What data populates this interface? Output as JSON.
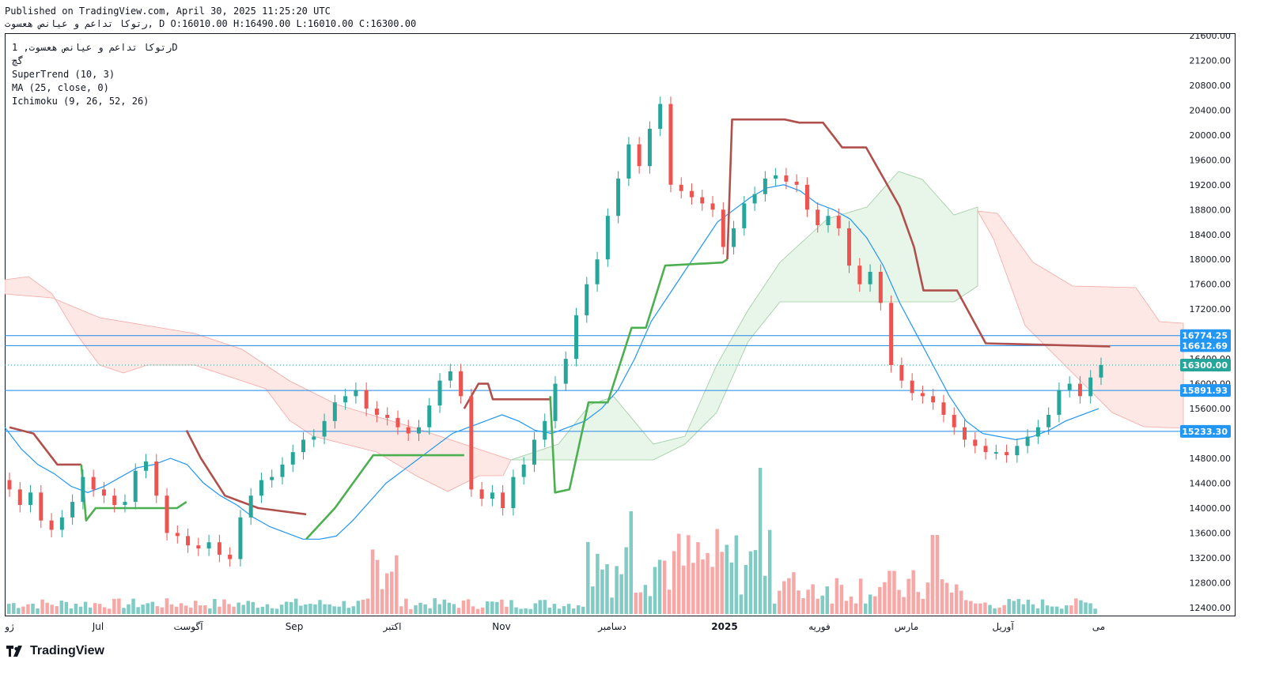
{
  "header": {
    "published_line": "Published on TradingView.com, April 30, 2025 11:25:20 UTC",
    "ohlc_line": "رتوکا تداعم و عیانص هعسوت, D O:16010.00 H:16490.00 L:16010.00 C:16300.00"
  },
  "legend": {
    "symbol_line": "رتوکا تداعم و عیانص هعسوت, 1D",
    "exchange": "گچ",
    "supertrend": "SuperTrend (10, 3)",
    "ma": "MA (25, close, 0)",
    "ichimoku": "Ichimoku (9, 26, 52, 26)"
  },
  "branding": {
    "logo_text": "TradingView"
  },
  "colors": {
    "up": "#26a69a",
    "down": "#ef5350",
    "vol_up": "#80cbc4",
    "vol_down": "#f7a8a6",
    "st_up": "#4caf50",
    "st_down": "#b0504c",
    "ma": "#2196f3",
    "level": "#1e88e5",
    "cloud_green": "#e8f5e9",
    "cloud_red": "#fde8e6"
  },
  "chart_data": {
    "type": "candlestick",
    "symbol": "رتوکا تداعم و عیانص هعسوت",
    "interval": "1D",
    "yaxis": {
      "range": [
        12200,
        21800
      ],
      "ticks": [
        21600,
        21200,
        20800,
        20400,
        20000,
        19600,
        19200,
        18800,
        18400,
        18000,
        17600,
        17200,
        16800,
        16400,
        16000,
        15600,
        15200,
        14800,
        14400,
        14000,
        13600,
        13200,
        12800,
        12400
      ]
    },
    "xaxis": {
      "labels": [
        "ژو",
        "Jul",
        "آگوست",
        "Sep",
        "اکتبر",
        "Nov",
        "دسامبر",
        "2025",
        "فوریه",
        "مارس",
        "آوریل",
        "می"
      ]
    },
    "last_bar": {
      "open": 16010,
      "high": 16490,
      "low": 16010,
      "close": 16300
    },
    "horizontal_levels": [
      16774.25,
      16612.69,
      15891.93,
      15233.3
    ],
    "price_labels": [
      "16774.25",
      "16612.69",
      "16300.00",
      "15891.93",
      "15233.30"
    ],
    "close_series": [
      14300,
      14050,
      14250,
      13800,
      13650,
      13850,
      14100,
      14500,
      14300,
      14200,
      14050,
      14100,
      14600,
      14750,
      14200,
      13600,
      13550,
      13400,
      13350,
      13450,
      13250,
      13180,
      13850,
      14200,
      14450,
      14500,
      14700,
      14900,
      15100,
      15150,
      15400,
      15700,
      15800,
      15900,
      15600,
      15500,
      15450,
      15300,
      15200,
      15300,
      15650,
      16050,
      16200,
      15800,
      14300,
      14150,
      14250,
      14000,
      14500,
      14700,
      15100,
      15400,
      16000,
      16400,
      17100,
      17600,
      18000,
      18700,
      19300,
      19850,
      19500,
      20100,
      20500,
      19200,
      19100,
      19000,
      18900,
      18800,
      18200,
      18500,
      18900,
      19050,
      19300,
      19350,
      19250,
      19200,
      18800,
      18550,
      18700,
      18500,
      17900,
      17600,
      17800,
      17300,
      16300,
      16050,
      15850,
      15800,
      15700,
      15500,
      15300,
      15100,
      15000,
      14900,
      14900,
      14850,
      15000,
      15150,
      15300,
      15500,
      15900,
      16000,
      15800,
      16100,
      16300
    ],
    "supertrend_segments": [
      {
        "trend": "down",
        "points": [
          [
            0,
            15300
          ],
          [
            5,
            15200
          ],
          [
            10,
            14700
          ],
          [
            15,
            14700
          ]
        ]
      },
      {
        "trend": "up",
        "points": [
          [
            15,
            14700
          ],
          [
            16,
            13800
          ],
          [
            18,
            14000
          ],
          [
            35,
            14000
          ],
          [
            37,
            14100
          ]
        ]
      },
      {
        "trend": "down",
        "points": [
          [
            37,
            15250
          ],
          [
            40,
            14800
          ],
          [
            45,
            14200
          ],
          [
            52,
            14000
          ],
          [
            62,
            13900
          ]
        ]
      },
      {
        "trend": "up",
        "points": [
          [
            62,
            13500
          ],
          [
            68,
            14000
          ],
          [
            76,
            14850
          ],
          [
            95,
            14850
          ]
        ]
      },
      {
        "trend": "down",
        "points": [
          [
            95,
            15600
          ],
          [
            98,
            16000
          ],
          [
            100,
            16000
          ],
          [
            101,
            15750
          ],
          [
            113,
            15750
          ]
        ]
      },
      {
        "trend": "up",
        "points": [
          [
            113,
            15800
          ],
          [
            114,
            14250
          ],
          [
            117,
            14300
          ],
          [
            121,
            15700
          ],
          [
            125,
            15700
          ],
          [
            130,
            16900
          ],
          [
            133,
            16900
          ],
          [
            137,
            17900
          ],
          [
            149,
            17950
          ],
          [
            150,
            18000
          ]
        ]
      },
      {
        "trend": "down",
        "points": [
          [
            150,
            18000
          ],
          [
            151,
            20250
          ],
          [
            162,
            20250
          ],
          [
            165,
            20200
          ],
          [
            170,
            20200
          ],
          [
            174,
            19800
          ],
          [
            179,
            19800
          ],
          [
            186,
            18850
          ],
          [
            189,
            18200
          ],
          [
            191,
            17500
          ],
          [
            198,
            17500
          ],
          [
            204,
            16650
          ],
          [
            230,
            16600
          ]
        ]
      }
    ],
    "ma_series": [
      15300,
      14950,
      14700,
      14550,
      14350,
      14250,
      14350,
      14500,
      14650,
      14700,
      14800,
      14700,
      14400,
      14200,
      14050,
      13850,
      13700,
      13600,
      13500,
      13500,
      13550,
      13800,
      14100,
      14400,
      14600,
      14800,
      15000,
      15200,
      15300,
      15400,
      15500,
      15400,
      15250,
      15200,
      15300,
      15400,
      15600,
      15900,
      16400,
      17000,
      17400,
      17800,
      18200,
      18600,
      18800,
      19000,
      19150,
      19200,
      19100,
      18900,
      18800,
      18650,
      18350,
      17900,
      17300,
      16800,
      16300,
      15800,
      15400,
      15200,
      15150,
      15100,
      15150,
      15250,
      15400,
      15500,
      15600
    ]
  }
}
